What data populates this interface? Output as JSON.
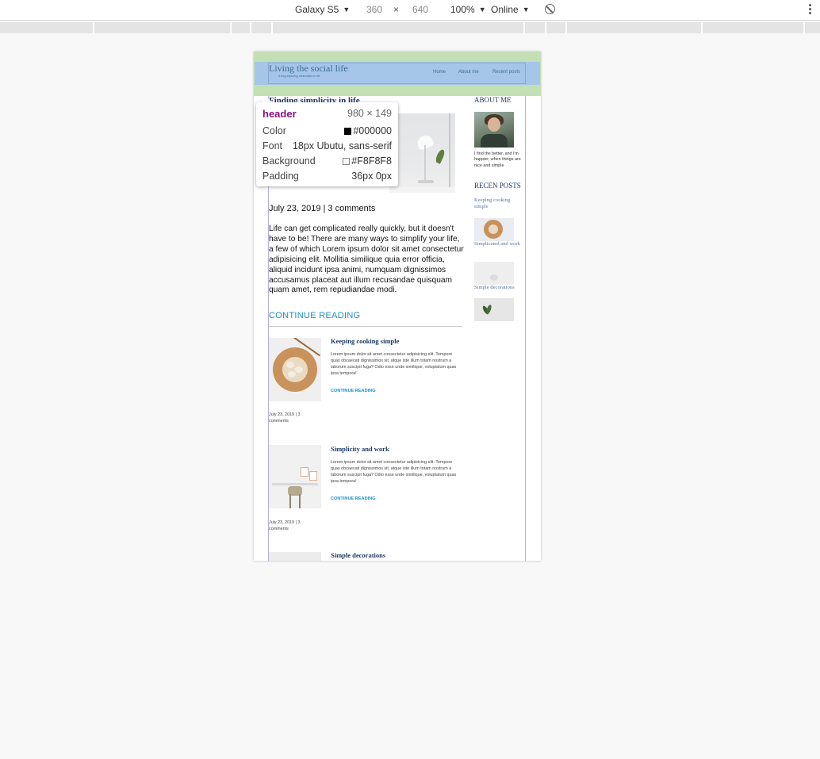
{
  "toolbar": {
    "device": "Galaxy S5",
    "width": "360",
    "times": "×",
    "height": "640",
    "zoom": "100%",
    "network": "Online"
  },
  "header": {
    "site_title": "Living the social life",
    "tagline": "A blog exploring minimalism in life",
    "nav": [
      "Home",
      "About me",
      "Recent posts"
    ]
  },
  "featured": {
    "title": "Finding simplicity in life",
    "meta": "July 23, 2019 | 3 comments",
    "excerpt": "Life can get complicated really quickly, but it doesn't have to be! There are many ways to simplify your life, a few of which Lorem ipsum dolor sit amet consectetur adipisicing elit. Mollitia similique quia error officia, aliquid incidunt ipsa animi, numquam dignissimos accusamus placeat aut illum recusandae quisquam quam amet, rem repudiandae modi.",
    "more": "CONTINUE READING"
  },
  "posts": [
    {
      "title": "Keeping cooking simple",
      "excerpt": "Lorem ipsum dolor sit amet consectetur adipisicing elit. Tempore quas obcaecati dignissimos sit, atque iste illum totam nostrum a laborum suscipit fuga? Odio esse unde similique, voluptatum quas ipsa tempora!",
      "more": "CONTINUE READING",
      "meta": "July 23, 2019 | 3 comments"
    },
    {
      "title": "Simplicity and work",
      "excerpt": "Lorem ipsum dolor sit amet consectetur adipisicing elit. Tempore quas obcaecati dignissimos sit, atque iste illum totam nostrum a laborum suscipit fuga? Odio esse unde similique, voluptatum quas ipsa tempora!",
      "more": "CONTINUE READING",
      "meta": "July 23, 2019 | 3 comments"
    },
    {
      "title": "Simple decorations"
    }
  ],
  "sidebar": {
    "about_heading": "ABOUT ME",
    "about_text": "I find the better, and i'm happier, when things are nice and simple",
    "recent_heading": "RECEN POSTS",
    "recent": [
      "Keeping cooking simple",
      "Simplicated and work",
      "Simple decorations"
    ]
  },
  "inspector": {
    "tag": "header",
    "size": "980 × 149",
    "rows": [
      {
        "label": "Color",
        "value": "#000000",
        "swatch": "#000000"
      },
      {
        "label": "Font",
        "value": "18px Ubutu, sans-serif"
      },
      {
        "label": "Background",
        "value": "#F8F8F8",
        "swatch": "#F8F8F8"
      },
      {
        "label": "Padding",
        "value": "36px 0px"
      }
    ]
  },
  "colors": {
    "padding_highlight": "#c3dfb4",
    "content_highlight": "#a5c5e9",
    "link": "#1d8fc4",
    "heading": "#1f3a64"
  }
}
